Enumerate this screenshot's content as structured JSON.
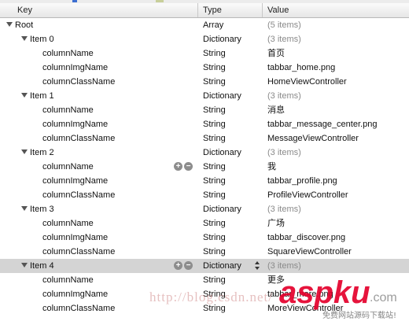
{
  "header": {
    "key": "Key",
    "type": "Type",
    "value": "Value"
  },
  "rows": [
    {
      "key": "Root",
      "type": "Array",
      "value": "(5 items)",
      "level": 0,
      "expanded": true,
      "dim": true
    },
    {
      "key": "Item 0",
      "type": "Dictionary",
      "value": "(3 items)",
      "level": 1,
      "expanded": true,
      "dim": true
    },
    {
      "key": "columnName",
      "type": "String",
      "value": "首页",
      "level": 2
    },
    {
      "key": "columnImgName",
      "type": "String",
      "value": "tabbar_home.png",
      "level": 2
    },
    {
      "key": "columnClassName",
      "type": "String",
      "value": "HomeViewController",
      "level": 2
    },
    {
      "key": "Item 1",
      "type": "Dictionary",
      "value": "(3 items)",
      "level": 1,
      "expanded": true,
      "dim": true
    },
    {
      "key": "columnName",
      "type": "String",
      "value": "消息",
      "level": 2
    },
    {
      "key": "columnImgName",
      "type": "String",
      "value": "tabbar_message_center.png",
      "level": 2
    },
    {
      "key": "columnClassName",
      "type": "String",
      "value": "MessageViewController",
      "level": 2
    },
    {
      "key": "Item 2",
      "type": "Dictionary",
      "value": "(3 items)",
      "level": 1,
      "expanded": true,
      "dim": true
    },
    {
      "key": "columnName",
      "type": "String",
      "value": "我",
      "level": 2,
      "addremove": true
    },
    {
      "key": "columnImgName",
      "type": "String",
      "value": "tabbar_profile.png",
      "level": 2
    },
    {
      "key": "columnClassName",
      "type": "String",
      "value": "ProfileViewController",
      "level": 2
    },
    {
      "key": "Item 3",
      "type": "Dictionary",
      "value": "(3 items)",
      "level": 1,
      "expanded": true,
      "dim": true
    },
    {
      "key": "columnName",
      "type": "String",
      "value": "广场",
      "level": 2
    },
    {
      "key": "columnImgName",
      "type": "String",
      "value": "tabbar_discover.png",
      "level": 2
    },
    {
      "key": "columnClassName",
      "type": "String",
      "value": "SquareViewController",
      "level": 2
    },
    {
      "key": "Item 4",
      "type": "Dictionary",
      "value": "(3 items)",
      "level": 1,
      "expanded": true,
      "dim": true,
      "selected": true,
      "addremove": true,
      "stepper": true
    },
    {
      "key": "columnName",
      "type": "String",
      "value": "更多",
      "level": 2
    },
    {
      "key": "columnImgName",
      "type": "String",
      "value": "tabbar_more.png",
      "level": 2
    },
    {
      "key": "columnClassName",
      "type": "String",
      "value": "MoreViewController",
      "level": 2
    }
  ],
  "icons": {
    "expand": "disclosure-triangle-icon",
    "add": "plus-circle-icon",
    "remove": "minus-circle-icon",
    "stepper": "up-down-stepper-icon"
  },
  "watermark": {
    "url": "http://blog.csdn.net/",
    "brand": "aspku",
    "brand_suffix": ".com",
    "tagline": "免费网站源码下载站!"
  },
  "colors": {
    "selected_row": "#d4d4d4",
    "dim_text": "#8a8a8a",
    "brand_red": "#e4002b"
  }
}
